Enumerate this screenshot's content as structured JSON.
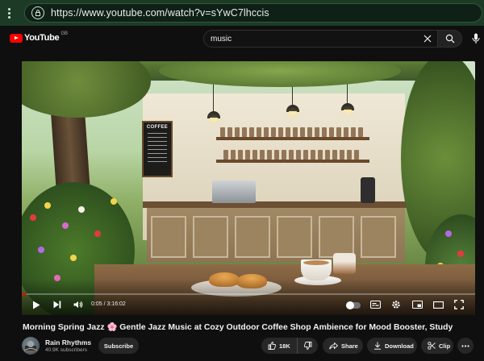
{
  "browser": {
    "url": "https://www.youtube.com/watch?v=sYwC7lhccis"
  },
  "header": {
    "logo_text": "YouTube",
    "country_code": "GB",
    "search_value": "music",
    "icons": {
      "clear": "close-icon",
      "search": "search-icon",
      "mic": "mic-icon"
    }
  },
  "video": {
    "menu_board_title": "COFFEE",
    "time_display": "0:05 / 3:16:02",
    "progress": 0.0004,
    "title": "Morning Spring Jazz 🌸 Gentle Jazz Music at Cozy Outdoor Coffee Shop Ambience for Mood Booster, Study"
  },
  "channel": {
    "name": "Rain Rhythms",
    "subscribers": "40.9K subscribers",
    "subscribe_label": "Subscribe"
  },
  "actions": {
    "like_count": "18K",
    "share_label": "Share",
    "download_label": "Download",
    "clip_label": "Clip"
  },
  "colors": {
    "browser_bar": "#1d3a27",
    "background": "#0f0f0f",
    "accent_red": "#ff0000",
    "pill_bg": "#272727"
  }
}
